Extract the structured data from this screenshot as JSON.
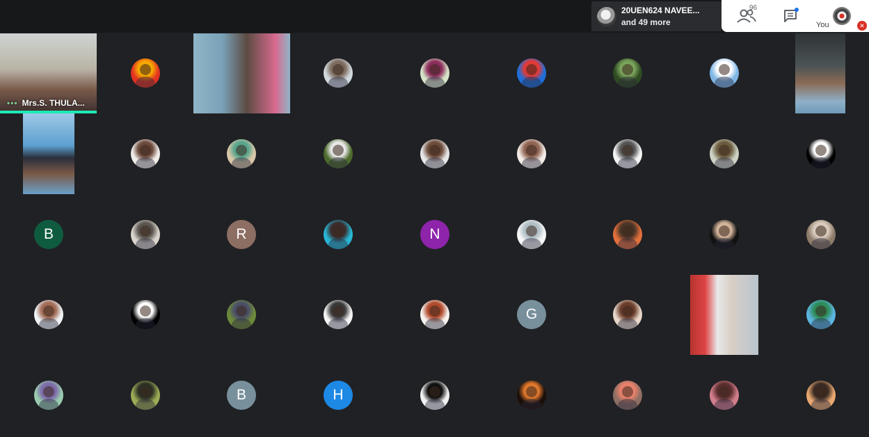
{
  "top_bar": {
    "pinned": {
      "line1": "20UEN624 NAVEE...",
      "line2": "and 49 more"
    },
    "participant_count": "96",
    "self_label": "You",
    "icons": {
      "people": "people-icon",
      "chat": "chat-icon",
      "mic_off": "mic-off-icon"
    }
  },
  "tiles": [
    {
      "kind": "video",
      "name": "Mrs.S. THULA...",
      "speaking": true
    },
    {
      "kind": "photo",
      "colors": [
        "#e23222",
        "#f6a800"
      ]
    },
    {
      "kind": "video"
    },
    {
      "kind": "photo",
      "colors": [
        "#cfd8dc",
        "#7d6b5f"
      ]
    },
    {
      "kind": "photo",
      "colors": [
        "#d7e3c8",
        "#8b2d5d"
      ]
    },
    {
      "kind": "photo",
      "colors": [
        "#1e6fd9",
        "#e53935"
      ]
    },
    {
      "kind": "photo",
      "colors": [
        "#2e4a22",
        "#7aa35b"
      ]
    },
    {
      "kind": "photo",
      "colors": [
        "#7fb6e5",
        "#ffffff"
      ]
    },
    {
      "kind": "video"
    },
    {
      "kind": "video"
    },
    {
      "kind": "photo",
      "colors": [
        "#f0ece8",
        "#6b4a3c"
      ]
    },
    {
      "kind": "photo",
      "colors": [
        "#d8c7a8",
        "#58a58c"
      ]
    },
    {
      "kind": "photo",
      "colors": [
        "#4d6b2d",
        "#e7e7e7"
      ]
    },
    {
      "kind": "photo",
      "colors": [
        "#e6e6e6",
        "#6c4b3a"
      ]
    },
    {
      "kind": "photo",
      "colors": [
        "#f2ebe6",
        "#8f6352"
      ]
    },
    {
      "kind": "photo",
      "colors": [
        "#f4f4f4",
        "#555555"
      ]
    },
    {
      "kind": "photo",
      "colors": [
        "#cdd3c4",
        "#6a5a3d"
      ]
    },
    {
      "kind": "photo",
      "colors": [
        "#000000",
        "#ffffff"
      ]
    },
    {
      "kind": "letter",
      "letter": "B",
      "color": "#0f5b40"
    },
    {
      "kind": "photo",
      "colors": [
        "#d9d4cc",
        "#5a554f"
      ]
    },
    {
      "kind": "letter",
      "letter": "R",
      "color": "#8d6e63"
    },
    {
      "kind": "photo",
      "colors": [
        "#29b6d5",
        "#3b2b2b"
      ]
    },
    {
      "kind": "letter",
      "letter": "N",
      "color": "#8e24aa"
    },
    {
      "kind": "photo",
      "colors": [
        "#f6f6f6",
        "#b0bec5"
      ]
    },
    {
      "kind": "photo",
      "colors": [
        "#e2703d",
        "#4a3526"
      ]
    },
    {
      "kind": "photo",
      "colors": [
        "#111111",
        "#d2b49a"
      ]
    },
    {
      "kind": "photo",
      "colors": [
        "#8d7b6a",
        "#d8cbbd"
      ]
    },
    {
      "kind": "photo",
      "colors": [
        "#eef3f6",
        "#a06a55"
      ]
    },
    {
      "kind": "photo",
      "colors": [
        "#000000",
        "#ffffff"
      ]
    },
    {
      "kind": "photo",
      "colors": [
        "#6d8b3a",
        "#4b4f68"
      ]
    },
    {
      "kind": "photo",
      "colors": [
        "#f4f4f4",
        "#3a3a3a"
      ]
    },
    {
      "kind": "photo",
      "colors": [
        "#f6f2ee",
        "#b04a2d"
      ]
    },
    {
      "kind": "letter",
      "letter": "G",
      "color": "#78909c"
    },
    {
      "kind": "photo",
      "colors": [
        "#e8d7c8",
        "#6a3d2c"
      ]
    },
    {
      "kind": "video"
    },
    {
      "kind": "photo",
      "colors": [
        "#5cb4e0",
        "#2e8b57"
      ]
    },
    {
      "kind": "photo",
      "colors": [
        "#9acbb0",
        "#7d6aa8"
      ]
    },
    {
      "kind": "photo",
      "colors": [
        "#9cab55",
        "#2c3024"
      ]
    },
    {
      "kind": "letter",
      "letter": "B",
      "color": "#78909c"
    },
    {
      "kind": "letter",
      "letter": "H",
      "color": "#1e88e5"
    },
    {
      "kind": "photo",
      "colors": [
        "#f2f2f2",
        "#111111"
      ]
    },
    {
      "kind": "photo",
      "colors": [
        "#1a0f0a",
        "#e0782d"
      ]
    },
    {
      "kind": "photo",
      "colors": [
        "#8d6e63",
        "#e8806a"
      ]
    },
    {
      "kind": "photo",
      "colors": [
        "#d27d8b",
        "#5a2e2e"
      ]
    },
    {
      "kind": "photo",
      "colors": [
        "#e8a970",
        "#3a2a24"
      ]
    }
  ]
}
